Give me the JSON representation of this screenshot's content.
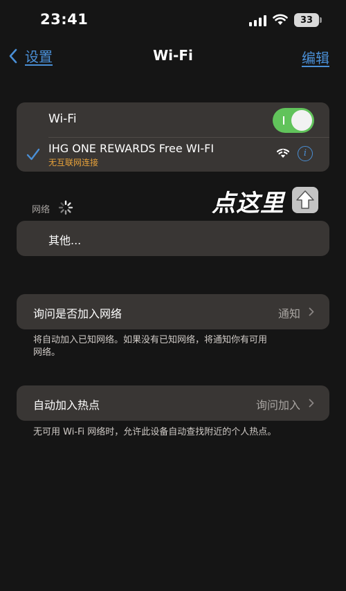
{
  "status_bar": {
    "time": "23:41",
    "battery": "33"
  },
  "nav": {
    "back_label": "设置",
    "title": "Wi-Fi",
    "edit_label": "编辑"
  },
  "wifi": {
    "label": "Wi-Fi",
    "enabled": true,
    "connected_network": {
      "name": "IHG ONE REWARDS Free WI-FI",
      "status": "无互联网连接"
    }
  },
  "networks": {
    "section_label": "网络",
    "other_label": "其他..."
  },
  "annotation": {
    "callout": "点这里"
  },
  "ask_to_join": {
    "label": "询问是否加入网络",
    "value": "通知",
    "footer": "将自动加入已知网络。如果没有已知网络，将通知你有可用网络。"
  },
  "auto_hotspot": {
    "label": "自动加入热点",
    "value": "询问加入",
    "footer": "无可用 Wi-Fi 网络时，允许此设备自动查找附近的个人热点。"
  },
  "colors": {
    "accent": "#4a8fd6",
    "toggle_on": "#61c35b",
    "warning": "#e8a23a"
  }
}
